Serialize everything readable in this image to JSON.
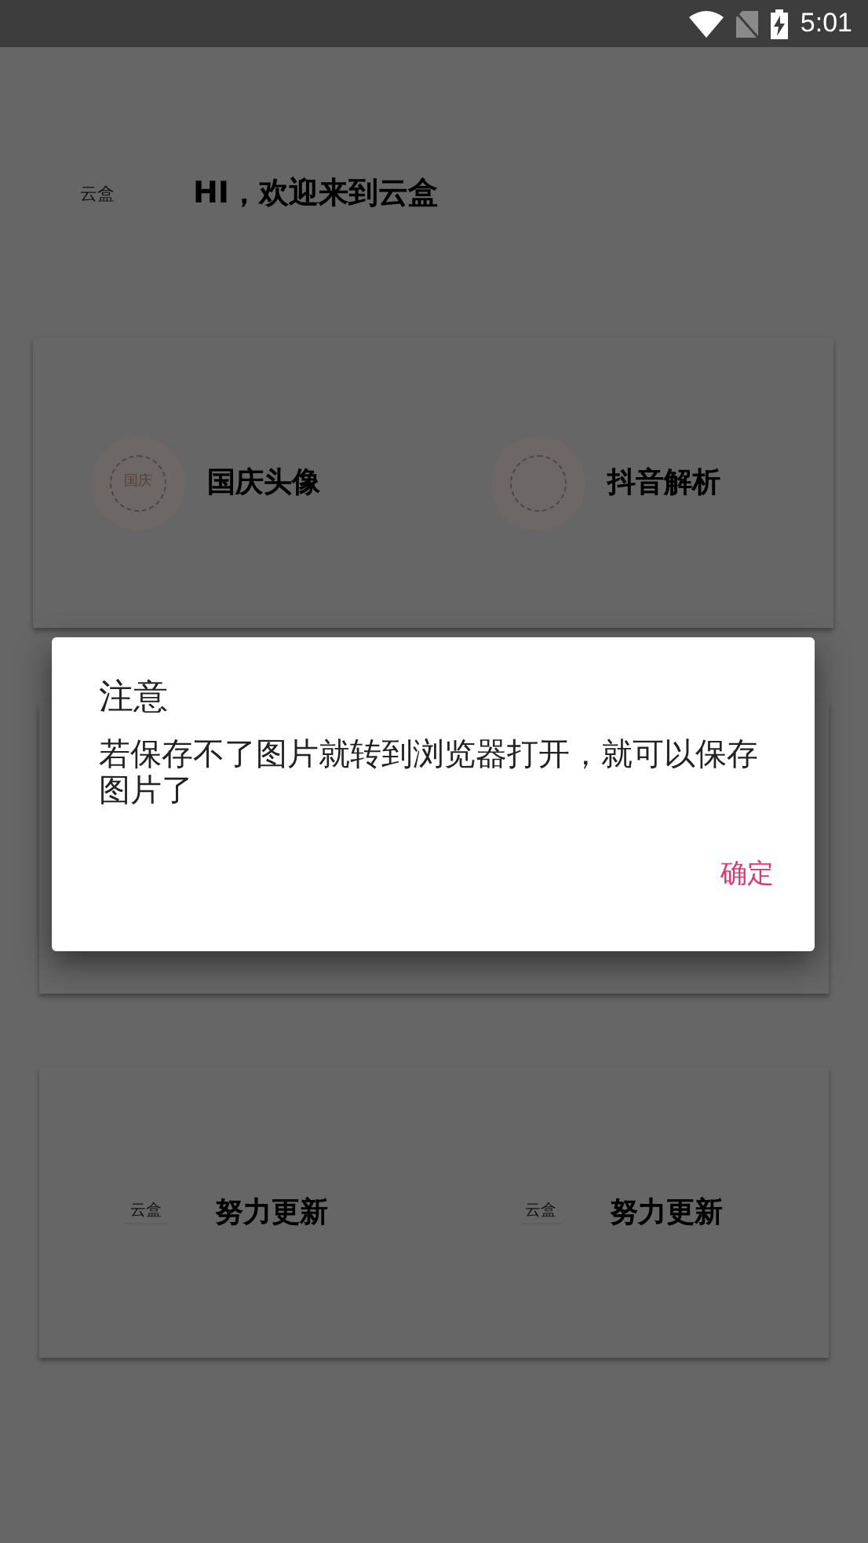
{
  "status_bar": {
    "time": "5:01"
  },
  "header": {
    "logo_text": "云盒",
    "greeting": "HI，欢迎来到云盒"
  },
  "cards": [
    {
      "kind": "feature",
      "items": [
        {
          "label": "国庆头像",
          "icon_text": "国庆"
        },
        {
          "label": "抖音解析"
        }
      ]
    },
    {
      "kind": "upcoming",
      "items": [
        {
          "label": "努力更新",
          "icon_text": "云盒"
        },
        {
          "label": "努力更新",
          "icon_text": "云盒"
        }
      ]
    }
  ],
  "dialog": {
    "title": "注意",
    "message": "若保存不了图片就转到浏览器打开，就可以保存图片了",
    "button": "确定"
  }
}
